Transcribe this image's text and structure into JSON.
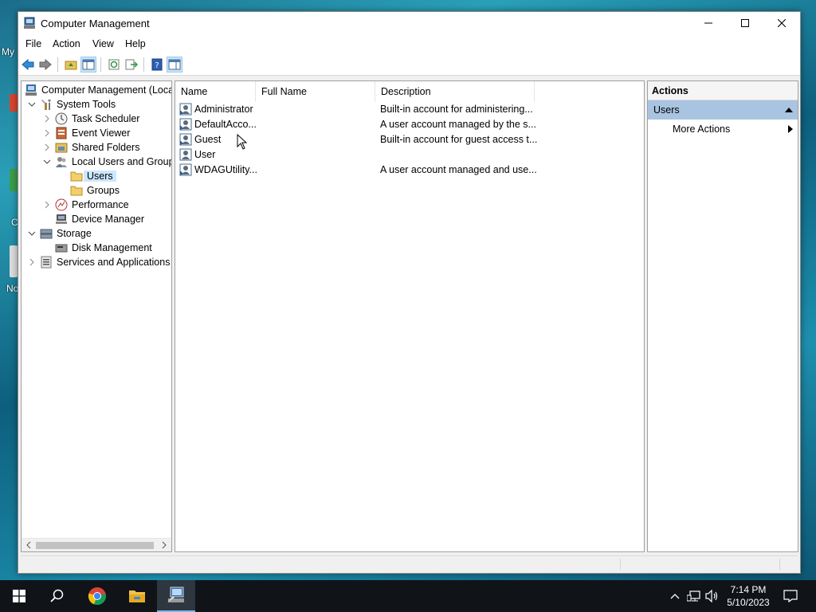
{
  "desktop": {
    "fragment_top": "My",
    "fragment_bottom": "No",
    "fragment_mid": "C"
  },
  "window": {
    "title": "Computer Management",
    "menu": [
      "File",
      "Action",
      "View",
      "Help"
    ]
  },
  "tree": {
    "items": [
      {
        "label": "Computer Management (Local",
        "icon": "computer-management-icon",
        "arrow": "none"
      },
      {
        "label": "System Tools",
        "icon": "tools-icon",
        "arrow": "expanded"
      },
      {
        "label": "Task Scheduler",
        "icon": "clock-icon",
        "arrow": "collapsed"
      },
      {
        "label": "Event Viewer",
        "icon": "event-viewer-icon",
        "arrow": "collapsed"
      },
      {
        "label": "Shared Folders",
        "icon": "shared-folders-icon",
        "arrow": "collapsed"
      },
      {
        "label": "Local Users and Groups",
        "icon": "users-icon",
        "arrow": "expanded"
      },
      {
        "label": "Users",
        "icon": "folder-icon",
        "arrow": "none",
        "selected": true
      },
      {
        "label": "Groups",
        "icon": "folder-icon",
        "arrow": "none"
      },
      {
        "label": "Performance",
        "icon": "performance-icon",
        "arrow": "collapsed"
      },
      {
        "label": "Device Manager",
        "icon": "device-manager-icon",
        "arrow": "none"
      },
      {
        "label": "Storage",
        "icon": "storage-icon",
        "arrow": "expanded"
      },
      {
        "label": "Disk Management",
        "icon": "disk-icon",
        "arrow": "none"
      },
      {
        "label": "Services and Applications",
        "icon": "services-icon",
        "arrow": "collapsed"
      }
    ]
  },
  "list": {
    "columns": [
      "Name",
      "Full Name",
      "Description"
    ],
    "rows": [
      {
        "name": "Administrator",
        "full_name": "",
        "description": "Built-in account for administering..."
      },
      {
        "name": "DefaultAcco...",
        "full_name": "",
        "description": "A user account managed by the s..."
      },
      {
        "name": "Guest",
        "full_name": "",
        "description": "Built-in account for guest access t..."
      },
      {
        "name": "User",
        "full_name": "",
        "description": ""
      },
      {
        "name": "WDAGUtility...",
        "full_name": "",
        "description": "A user account managed and use..."
      }
    ]
  },
  "actions": {
    "header": "Actions",
    "group": "Users",
    "items": [
      "More Actions"
    ]
  },
  "taskbar": {
    "time": "7:14 PM",
    "date": "5/10/2023"
  },
  "colors": {
    "selection": "#cce8ff",
    "actions_group": "#a9c4e0",
    "taskbar": "#101418"
  }
}
